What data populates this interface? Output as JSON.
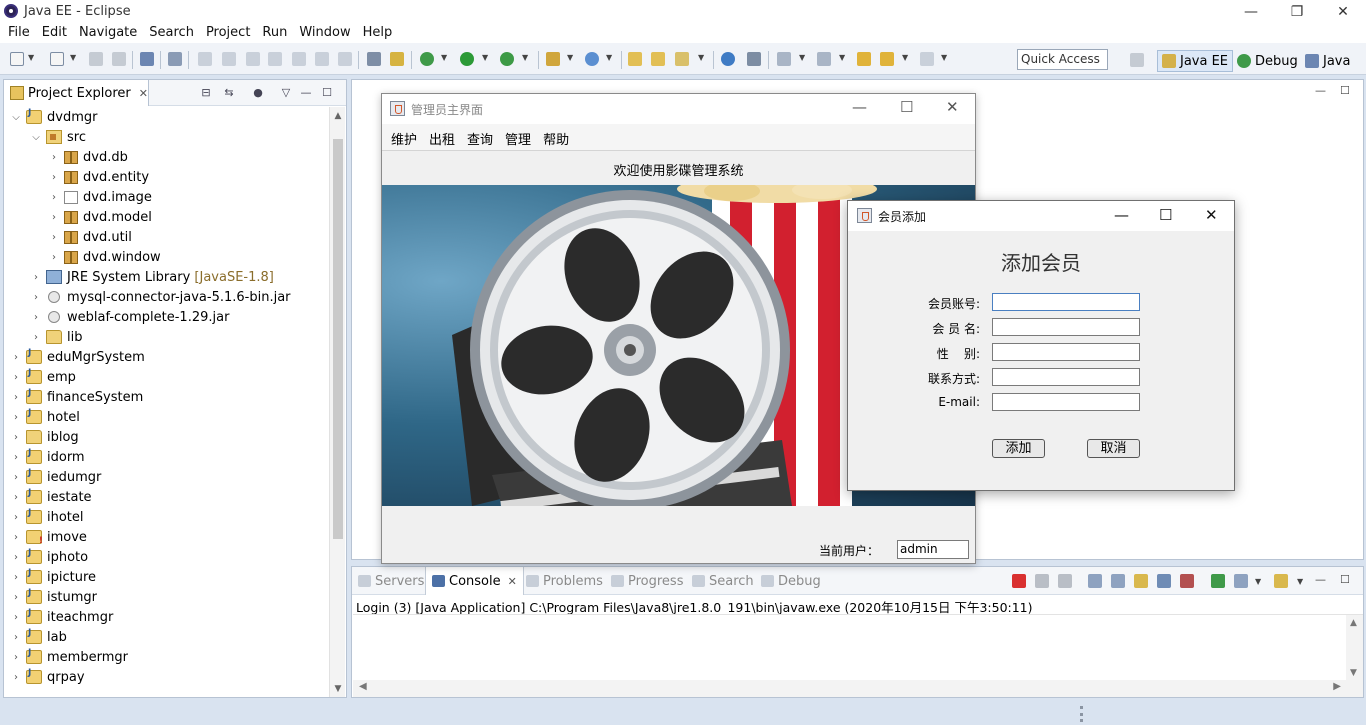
{
  "window": {
    "title": "Java EE - Eclipse"
  },
  "menubar": [
    "File",
    "Edit",
    "Navigate",
    "Search",
    "Project",
    "Run",
    "Window",
    "Help"
  ],
  "toolbar": {
    "quick_access": "Quick Access",
    "perspectives": [
      "Java EE",
      "Debug",
      "Java"
    ]
  },
  "explorer": {
    "tab_label": "Project Explorer",
    "items": [
      {
        "label": "dvdmgr",
        "icon": "project-icon"
      },
      {
        "label": "src",
        "icon": "source-folder-icon"
      },
      {
        "label": "dvd.db",
        "icon": "package-icon"
      },
      {
        "label": "dvd.entity",
        "icon": "package-icon"
      },
      {
        "label": "dvd.image",
        "icon": "empty-package-icon"
      },
      {
        "label": "dvd.model",
        "icon": "package-icon"
      },
      {
        "label": "dvd.util",
        "icon": "package-icon"
      },
      {
        "label": "dvd.window",
        "icon": "package-icon"
      },
      {
        "label": "JRE System Library",
        "hint": "[JavaSE-1.8]",
        "icon": "library-icon"
      },
      {
        "label": "mysql-connector-java-5.1.6-bin.jar",
        "icon": "jar-icon"
      },
      {
        "label": "weblaf-complete-1.29.jar",
        "icon": "jar-icon"
      },
      {
        "label": "lib",
        "icon": "folder-icon"
      },
      {
        "label": "eduMgrSystem",
        "icon": "project-icon"
      },
      {
        "label": "emp",
        "icon": "project-icon"
      },
      {
        "label": "financeSystem",
        "icon": "project-icon"
      },
      {
        "label": "hotel",
        "icon": "project-icon"
      },
      {
        "label": "iblog",
        "icon": "folder-icon"
      },
      {
        "label": "idorm",
        "icon": "project-icon"
      },
      {
        "label": "iedumgr",
        "icon": "project-icon"
      },
      {
        "label": "iestate",
        "icon": "project-icon"
      },
      {
        "label": "ihotel",
        "icon": "project-icon"
      },
      {
        "label": "imove",
        "icon": "project-error-icon"
      },
      {
        "label": "iphoto",
        "icon": "project-icon"
      },
      {
        "label": "ipicture",
        "icon": "project-icon"
      },
      {
        "label": "istumgr",
        "icon": "project-icon"
      },
      {
        "label": "iteachmgr",
        "icon": "project-icon"
      },
      {
        "label": "lab",
        "icon": "project-icon"
      },
      {
        "label": "membermgr",
        "icon": "project-icon"
      },
      {
        "label": "qrpay",
        "icon": "project-icon"
      }
    ]
  },
  "console": {
    "tabs": [
      "Servers",
      "Console",
      "Problems",
      "Progress",
      "Search",
      "Debug"
    ],
    "launch_line": "Login (3) [Java Application] C:\\Program Files\\Java8\\jre1.8.0_191\\bin\\javaw.exe (2020年10月15日 下午3:50:11)"
  },
  "main_window": {
    "title": "管理员主界面",
    "menu": [
      "维护",
      "出租",
      "查询",
      "管理",
      "帮助"
    ],
    "welcome": "欢迎使用影碟管理系统",
    "current_user_label": "当前用户：",
    "current_user": "admin"
  },
  "dialog": {
    "title": "会员添加",
    "heading": "添加会员",
    "fields": [
      {
        "label": "会员账号:",
        "value": ""
      },
      {
        "label": "会 员 名:",
        "value": ""
      },
      {
        "label": "性    别:",
        "value": ""
      },
      {
        "label": "联系方式:",
        "value": ""
      },
      {
        "label": "E-mail:",
        "value": ""
      }
    ],
    "add_button": "添加",
    "cancel_button": "取消"
  },
  "colors": {
    "accent": "#4a7fc1",
    "eclipse_frame": "#d9e3f0",
    "popcorn_red": "#d2202f"
  }
}
